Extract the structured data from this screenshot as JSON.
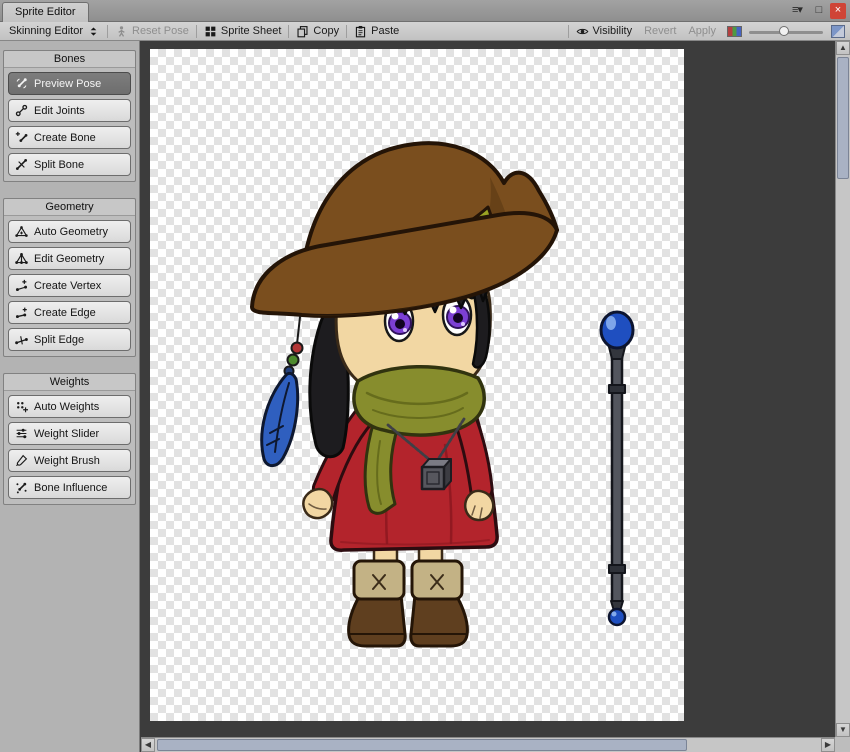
{
  "ui_colors": {
    "close_red": "#cf4436",
    "thumb": "#a9b2c4",
    "accent_selected": "#7d7d7d"
  },
  "window": {
    "tab": "Sprite Editor",
    "menu_glyph": "≡▾",
    "maximize_glyph": "□",
    "close_glyph": "×"
  },
  "toolbar": {
    "mode": "Skinning Editor",
    "reset_pose": "Reset Pose",
    "sprite_sheet": "Sprite Sheet",
    "copy": "Copy",
    "paste": "Paste",
    "visibility": "Visibility",
    "revert": "Revert",
    "apply": "Apply"
  },
  "sidebar": {
    "panels": [
      {
        "title": "Bones",
        "items": [
          {
            "label": "Preview Pose",
            "icon": "preview-pose-icon",
            "selected": true
          },
          {
            "label": "Edit Joints",
            "icon": "edit-joints-icon",
            "selected": false
          },
          {
            "label": "Create Bone",
            "icon": "create-bone-icon",
            "selected": false
          },
          {
            "label": "Split Bone",
            "icon": "split-bone-icon",
            "selected": false
          }
        ]
      },
      {
        "title": "Geometry",
        "items": [
          {
            "label": "Auto Geometry",
            "icon": "auto-geometry-icon",
            "selected": false
          },
          {
            "label": "Edit Geometry",
            "icon": "edit-geometry-icon",
            "selected": false
          },
          {
            "label": "Create Vertex",
            "icon": "create-vertex-icon",
            "selected": false
          },
          {
            "label": "Create Edge",
            "icon": "create-edge-icon",
            "selected": false
          },
          {
            "label": "Split Edge",
            "icon": "split-edge-icon",
            "selected": false
          }
        ]
      },
      {
        "title": "Weights",
        "items": [
          {
            "label": "Auto Weights",
            "icon": "auto-weights-icon",
            "selected": false
          },
          {
            "label": "Weight Slider",
            "icon": "weight-slider-icon",
            "selected": false
          },
          {
            "label": "Weight Brush",
            "icon": "weight-brush-icon",
            "selected": false
          },
          {
            "label": "Bone Influence",
            "icon": "bone-influence-icon",
            "selected": false
          }
        ]
      }
    ]
  },
  "canvas": {
    "sprite": "chibi-witch-character-with-staff",
    "colors": {
      "hat": "#7a4e1e",
      "hat_dark": "#4f3310",
      "band": "#9aa323",
      "hair": "#1d1c1f",
      "skin": "#f2d7a3",
      "iris": "#7c3fd4",
      "dress": "#b3242c",
      "dress_dark": "#8a171f",
      "scarf": "#878d2d",
      "scarf_dark": "#666c1c",
      "boot": "#5f3f1f",
      "cuff": "#c3b285",
      "feather": "#2f5fbf",
      "orb": "#1f4fc0",
      "rod": "#53565e"
    }
  },
  "scrollbars": {
    "up": "▲",
    "down": "▼",
    "left": "◀",
    "right": "▶"
  }
}
